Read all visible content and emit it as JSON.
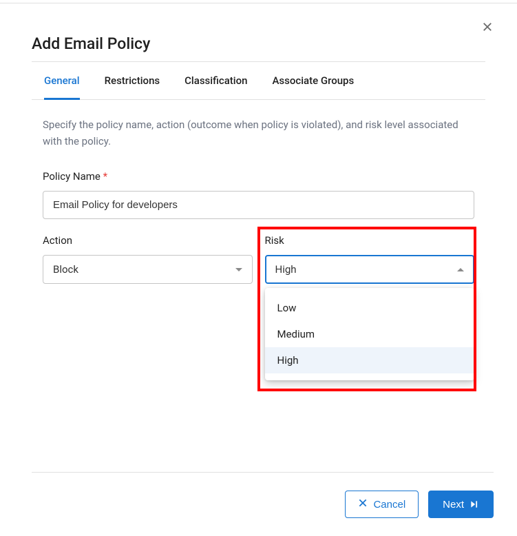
{
  "dialog": {
    "title": "Add Email Policy"
  },
  "tabs": {
    "items": [
      {
        "label": "General",
        "active": true
      },
      {
        "label": "Restrictions",
        "active": false
      },
      {
        "label": "Classification",
        "active": false
      },
      {
        "label": "Associate Groups",
        "active": false
      }
    ]
  },
  "content": {
    "description": "Specify the policy name, action (outcome when policy is violated), and risk level associated with the policy.",
    "fields": {
      "policy_name": {
        "label": "Policy Name",
        "required_marker": "*",
        "value": "Email Policy for developers"
      },
      "action": {
        "label": "Action",
        "value": "Block"
      },
      "risk": {
        "label": "Risk",
        "value": "High",
        "options": [
          {
            "label": "Low"
          },
          {
            "label": "Medium"
          },
          {
            "label": "High"
          }
        ]
      }
    }
  },
  "footer": {
    "cancel_label": "Cancel",
    "next_label": "Next"
  }
}
